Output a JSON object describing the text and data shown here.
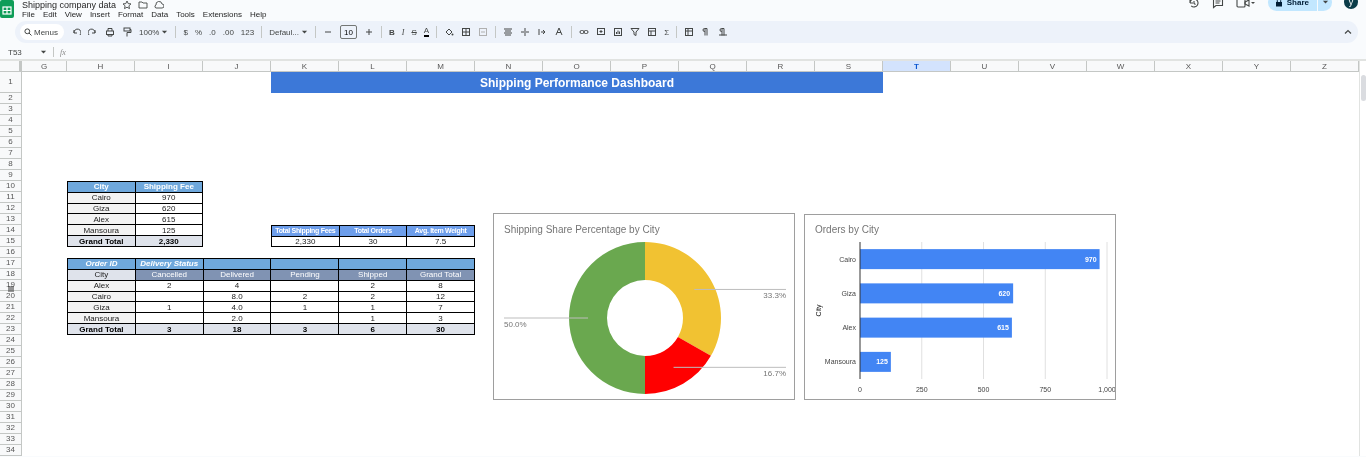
{
  "document": {
    "title": "Shipping company data",
    "menu": [
      "File",
      "Edit",
      "View",
      "Insert",
      "Format",
      "Data",
      "Tools",
      "Extensions",
      "Help"
    ]
  },
  "share_button": "Share",
  "avatar": "y",
  "toolbar": {
    "search_placeholder": "Menus",
    "zoom": "100%",
    "format_buttons": [
      "$",
      "%",
      ".0",
      ".00",
      "123"
    ],
    "font": "Defaul...",
    "font_size": "10",
    "style_buttons": [
      "B",
      "I",
      "S",
      "A"
    ],
    "sum": "Σ"
  },
  "formula_bar": {
    "name_box": "T53",
    "fx": "fx"
  },
  "columns": [
    {
      "label": "G",
      "selected": false
    },
    {
      "label": "H",
      "selected": false
    },
    {
      "label": "I",
      "selected": false
    },
    {
      "label": "J",
      "selected": false
    },
    {
      "label": "K",
      "selected": false
    },
    {
      "label": "L",
      "selected": false
    },
    {
      "label": "M",
      "selected": false
    },
    {
      "label": "N",
      "selected": false
    },
    {
      "label": "O",
      "selected": false
    },
    {
      "label": "P",
      "selected": false
    },
    {
      "label": "Q",
      "selected": false
    },
    {
      "label": "R",
      "selected": false
    },
    {
      "label": "S",
      "selected": false
    },
    {
      "label": "T",
      "selected": true
    },
    {
      "label": "U",
      "selected": false
    },
    {
      "label": "V",
      "selected": false
    },
    {
      "label": "W",
      "selected": false
    },
    {
      "label": "X",
      "selected": false
    },
    {
      "label": "Y",
      "selected": false
    },
    {
      "label": "Z",
      "selected": false
    }
  ],
  "rows": [
    "1",
    "2",
    "3",
    "4",
    "5",
    "6",
    "7",
    "8",
    "9",
    "10",
    "11",
    "12",
    "13",
    "14",
    "15",
    "16",
    "17",
    "18",
    "19",
    "20",
    "21",
    "22",
    "23",
    "24",
    "25",
    "26",
    "27",
    "28",
    "29",
    "30",
    "31",
    "32",
    "33",
    "34"
  ],
  "dashboard_title": "Shipping Performance Dashboard",
  "fee_table": {
    "columns": [
      "City",
      "Shipping Fee"
    ],
    "rows": [
      {
        "kind": "body",
        "cells": [
          "Cairo",
          "970"
        ]
      },
      {
        "kind": "body",
        "cells": [
          "Giza",
          "620"
        ]
      },
      {
        "kind": "body",
        "cells": [
          "Alex",
          "615"
        ]
      },
      {
        "kind": "body",
        "cells": [
          "Mansoura",
          "125"
        ]
      },
      {
        "kind": "total",
        "cells": [
          "Grand Total",
          "2,330"
        ]
      }
    ]
  },
  "kpi_table": {
    "columns": [
      "Total Shipping Fees",
      "Total Orders",
      "Avg. Item Weight"
    ],
    "values": [
      "2,330",
      "30",
      "7.5"
    ]
  },
  "pivot_table": {
    "row_field": "Order ID",
    "column_field": "Delivery Status",
    "columns": [
      "City",
      "Cancelled",
      "Delivered",
      "Pending",
      "Shipped",
      "Grand Total"
    ],
    "rows": [
      {
        "kind": "body",
        "cells": [
          "Alex",
          "2",
          "4",
          null,
          "2",
          "8"
        ]
      },
      {
        "kind": "body",
        "cells": [
          "Cairo",
          null,
          "8.0",
          "2",
          "2",
          "12"
        ]
      },
      {
        "kind": "body",
        "cells": [
          "Giza",
          "1",
          "4.0",
          "1",
          "1",
          "7"
        ]
      },
      {
        "kind": "body",
        "cells": [
          "Mansoura",
          null,
          "2.0",
          null,
          "1",
          "3"
        ]
      },
      {
        "kind": "total",
        "cells": [
          "Grand Total",
          "3",
          "18",
          "3",
          "6",
          "30"
        ]
      }
    ]
  },
  "share_chart": {
    "chart_data": {
      "type": "donut",
      "title": "Shipping Share Percentage by City",
      "values": [
        33.3,
        16.7,
        50.0
      ],
      "colors": [
        "#f1c232",
        "#ff0000",
        "#6aa84f"
      ],
      "value_labels": [
        "33.3%",
        "16.7%",
        "50.0%"
      ]
    }
  },
  "orders_chart": {
    "chart_data": {
      "type": "bar",
      "orientation": "horizontal",
      "title": "Orders by City",
      "ylabel": "City",
      "categories": [
        "Cairo",
        "Giza",
        "Alex",
        "Mansoura"
      ],
      "series": [
        {
          "color": "#4285f4",
          "values": [
            970,
            620,
            615,
            125
          ]
        }
      ],
      "grid": true,
      "xlim": [
        0,
        1000
      ],
      "xticks": [
        0,
        250,
        500,
        750,
        {
          "value": 1000,
          "label": "1,000"
        }
      ],
      "data_labels": true
    }
  }
}
